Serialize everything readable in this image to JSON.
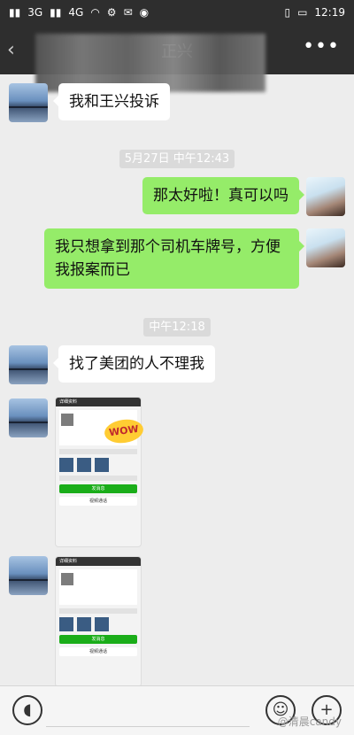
{
  "status_bar": {
    "left_icons": [
      "signal-icon",
      "signal-icon",
      "wifi-icon",
      "settings-icon",
      "message-icon",
      "weibo-icon"
    ],
    "left_labels": [
      "3G",
      "4G"
    ],
    "time": "12:19"
  },
  "nav": {
    "back_icon": "back-icon",
    "title": "正兴",
    "more_icon": "more-icon"
  },
  "messages": [
    {
      "side": "in",
      "text": "我和王兴投诉"
    },
    {
      "type": "time",
      "text": "5月27日 中午12:43"
    },
    {
      "side": "out",
      "text": "那太好啦！真可以吗"
    },
    {
      "side": "out",
      "text": "我只想拿到那个司机车牌号，方便我报案而已"
    },
    {
      "type": "time",
      "text": "中午12:18"
    },
    {
      "side": "in",
      "text": "找了美团的人不理我"
    },
    {
      "side": "in",
      "type": "image",
      "title": "详细资料",
      "button_send": "发消息",
      "button_call": "视频通话",
      "sticker_text": "WOW"
    },
    {
      "side": "in",
      "type": "image",
      "title": "详细资料",
      "button_send": "发消息",
      "button_call": "视频通话"
    }
  ],
  "input_bar": {
    "voice_icon": "voice-icon",
    "emoji_icon": "emoji-icon",
    "add_icon": "add-icon"
  },
  "watermark": "@清晨candy"
}
